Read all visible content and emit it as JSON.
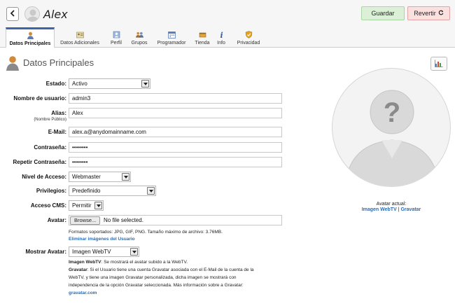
{
  "header": {
    "user_name": "Alex",
    "save_label": "Guardar",
    "revert_label": "Revertir"
  },
  "tabs": [
    {
      "label": "Datos Principales",
      "icon": "user-icon",
      "active": true
    },
    {
      "label": "Datos Adicionales",
      "icon": "profile-card-icon",
      "active": false
    },
    {
      "label": "Perfil",
      "icon": "profile-icon",
      "active": false
    },
    {
      "label": "Grupos",
      "icon": "groups-icon",
      "active": false
    },
    {
      "label": "Programador",
      "icon": "calendar-icon",
      "active": false
    },
    {
      "label": "Tienda",
      "icon": "cart-icon",
      "active": false
    },
    {
      "label": "Info",
      "icon": "info-icon",
      "active": false
    },
    {
      "label": "Privacidad",
      "icon": "shield-icon",
      "active": false
    }
  ],
  "section": {
    "title": "Datos Principales"
  },
  "form": {
    "estado": {
      "label": "Estado:",
      "value": "Activo"
    },
    "usuario": {
      "label": "Nombre de usuario:",
      "value": "admin3"
    },
    "alias": {
      "label": "Alias:",
      "sublabel": "(Nombre Público)",
      "value": "Alex"
    },
    "email": {
      "label": "E-Mail:",
      "value": "alex.a@anydomainname.com"
    },
    "password": {
      "label": "Contraseña:",
      "value": "••••••••"
    },
    "password_repeat": {
      "label": "Repetir Contraseña:",
      "value": "••••••••"
    },
    "nivel": {
      "label": "Nivel de Acceso:",
      "value": "Webmaster"
    },
    "privilegios": {
      "label": "Privilegios:",
      "value": "Predefinido"
    },
    "acceso_cms": {
      "label": "Acceso CMS:",
      "value": "Permitir"
    },
    "avatar": {
      "label": "Avatar:",
      "browse_label": "Browse...",
      "file_status": "No file selected.",
      "formats_note": "Formatos soportados: JPG, GIF, PNG. Tamaño máximo de archivo: 3.76MB.",
      "delete_link": "Eliminar imágenes del Usuario"
    },
    "mostrar_avatar": {
      "label": "Mostrar Avatar:",
      "value": "Imagen WebTV",
      "help_webtv_title": "Imagen WebTV",
      "help_webtv_text": ": Se mostrará el avatar subido a la WebTV.",
      "help_gravatar_title": "Gravatar",
      "help_gravatar_line1": ": Si el Usuario tiene una cuenta Gravatar asociada con el E-Mail de la cuenta de la",
      "help_gravatar_line2": "WebTV, y tiene una imagen Gravatar personalizada, dicha imagen se mostrará con",
      "help_gravatar_line3": "independencia de la opción Gravatar seleccionada. Más información sobre a Gravatar:",
      "gravatar_link": "gravatar.com"
    }
  },
  "avatar_panel": {
    "caption": "Avatar actual:",
    "link_webtv": "Imagen WebTV",
    "separator": "|",
    "link_gravatar": "Gravatar"
  },
  "colors": {
    "tab_active_border": "#3d66a8",
    "link": "#2b6cb5",
    "save_bg": "#dcf0d8",
    "revert_bg": "#fbe0e0"
  }
}
